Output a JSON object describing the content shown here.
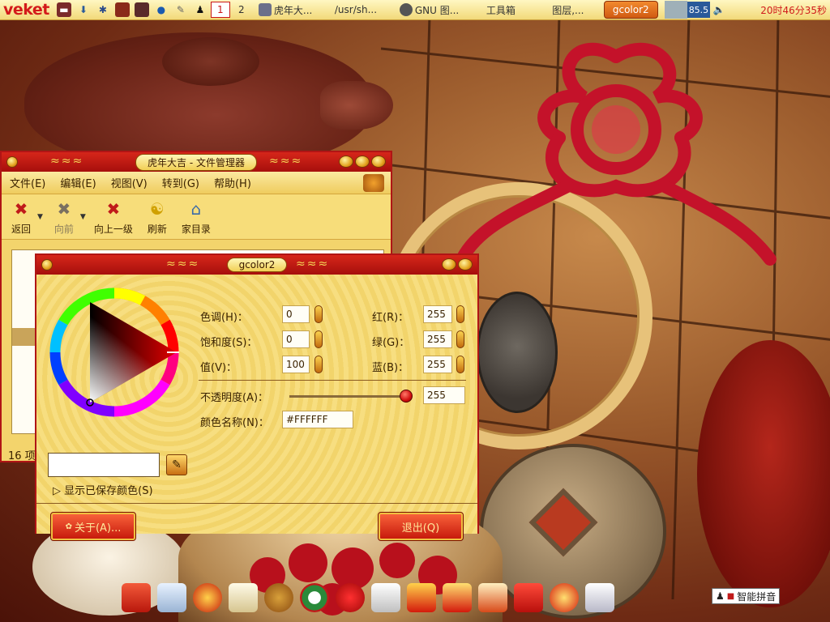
{
  "top_panel": {
    "logo": "veket",
    "workspaces": [
      "1",
      "2"
    ],
    "tasks": [
      {
        "label": "虎年大...",
        "color": "#6b6f8a"
      },
      {
        "label": "/usr/sh...",
        "color": "#444444"
      },
      {
        "label": "GNU 图...",
        "color": "#555555"
      },
      {
        "label": "工具箱",
        "color": ""
      },
      {
        "label": "图层,...",
        "color": ""
      }
    ],
    "active_task": "gcolor2",
    "net_value": "85.5",
    "clock": "20时46分35秒"
  },
  "file_manager": {
    "title": "虎年大吉 - 文件管理器",
    "menu": [
      "文件(E)",
      "编辑(E)",
      "视图(V)",
      "转到(G)",
      "帮助(H)"
    ],
    "toolbar": {
      "back": "返回",
      "forward": "向前",
      "up": "向上一级",
      "refresh": "刷新",
      "home": "家目录"
    },
    "status": "16 项"
  },
  "gcolor": {
    "title": "gcolor2",
    "hue_label": "色调(H)：",
    "hue_value": "0",
    "saturation_label": "饱和度(S)：",
    "saturation_value": "0",
    "value_label": "值(V)：",
    "value_value": "100",
    "red_label": "红(R)：",
    "red_value": "255",
    "green_label": "绿(G)：",
    "green_value": "255",
    "blue_label": "蓝(B)：",
    "blue_value": "255",
    "opacity_label": "不透明度(A)：",
    "opacity_value": "255",
    "name_label": "颜色名称(N)：",
    "name_value": "#FFFFFF",
    "expander": "显示已保存颜色(S)",
    "about_button": "关于(A)...",
    "quit_button": "退出(Q)",
    "selected_color": "#FFFFFF"
  },
  "ime": {
    "label": "智能拼音"
  },
  "dock_icons": [
    "red-envelope-icon",
    "monitor-icon",
    "lantern-icon",
    "calligraphy-icon",
    "firecracker-icon",
    "wreath-icon",
    "knot-icon",
    "card-icon",
    "fu-icon",
    "couplet-icon",
    "cake-icon",
    "gift-icon",
    "fu-badge-icon",
    "printer-icon"
  ],
  "colors": {
    "window_red": "#b01515",
    "window_gold": "#f3d46c",
    "clock_red": "#d01c1c"
  }
}
